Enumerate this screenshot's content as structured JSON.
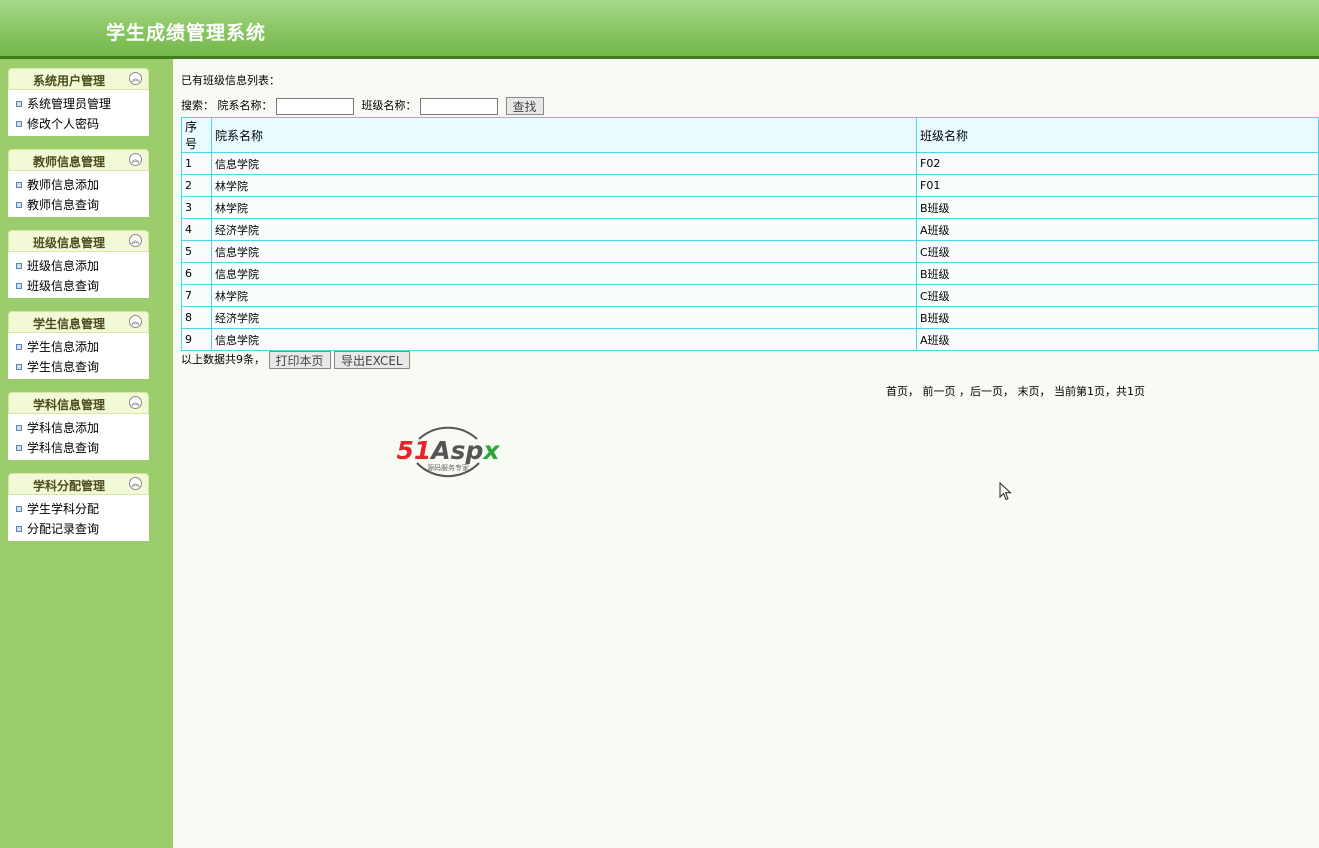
{
  "header": {
    "title": "学生成绩管理系统"
  },
  "sidebar": {
    "groups": [
      {
        "title": "系统用户管理",
        "items": [
          "系统管理员管理",
          "修改个人密码"
        ]
      },
      {
        "title": "教师信息管理",
        "items": [
          "教师信息添加",
          "教师信息查询"
        ]
      },
      {
        "title": "班级信息管理",
        "items": [
          "班级信息添加",
          "班级信息查询"
        ]
      },
      {
        "title": "学生信息管理",
        "items": [
          "学生信息添加",
          "学生信息查询"
        ]
      },
      {
        "title": "学科信息管理",
        "items": [
          "学科信息添加",
          "学科信息查询"
        ]
      },
      {
        "title": "学科分配管理",
        "items": [
          "学生学科分配",
          "分配记录查询"
        ]
      }
    ]
  },
  "main": {
    "list_title": "已有班级信息列表：",
    "search": {
      "prefix": "搜索：",
      "dept_label": "院系名称：",
      "dept_value": "",
      "class_label": "班级名称：",
      "class_value": "",
      "button": "查找"
    },
    "table": {
      "headers": [
        "序号",
        "院系名称",
        "班级名称"
      ],
      "rows": [
        [
          "1",
          "信息学院",
          "F02"
        ],
        [
          "2",
          "林学院",
          "F01"
        ],
        [
          "3",
          "林学院",
          "B班级"
        ],
        [
          "4",
          "经济学院",
          "A班级"
        ],
        [
          "5",
          "信息学院",
          "C班级"
        ],
        [
          "6",
          "信息学院",
          "B班级"
        ],
        [
          "7",
          "林学院",
          "C班级"
        ],
        [
          "8",
          "经济学院",
          "B班级"
        ],
        [
          "9",
          "信息学院",
          "A班级"
        ]
      ]
    },
    "footer": {
      "count_text": "以上数据共9条，",
      "print_button": "打印本页",
      "export_button": "导出EXCEL"
    },
    "pager": {
      "first": "首页",
      "prev": "前一页",
      "next": "后一页",
      "last": "末页",
      "status": "当前第1页，共1页"
    }
  },
  "logo": {
    "brand": "51Aspx",
    "tagline": "源码服务专家"
  },
  "colors": {
    "header_green": "#8dc968",
    "sidebar_green": "#9ccd6c",
    "table_border": "#4fd6ea",
    "logo_red": "#e4252b",
    "logo_green": "#2fa33c"
  }
}
